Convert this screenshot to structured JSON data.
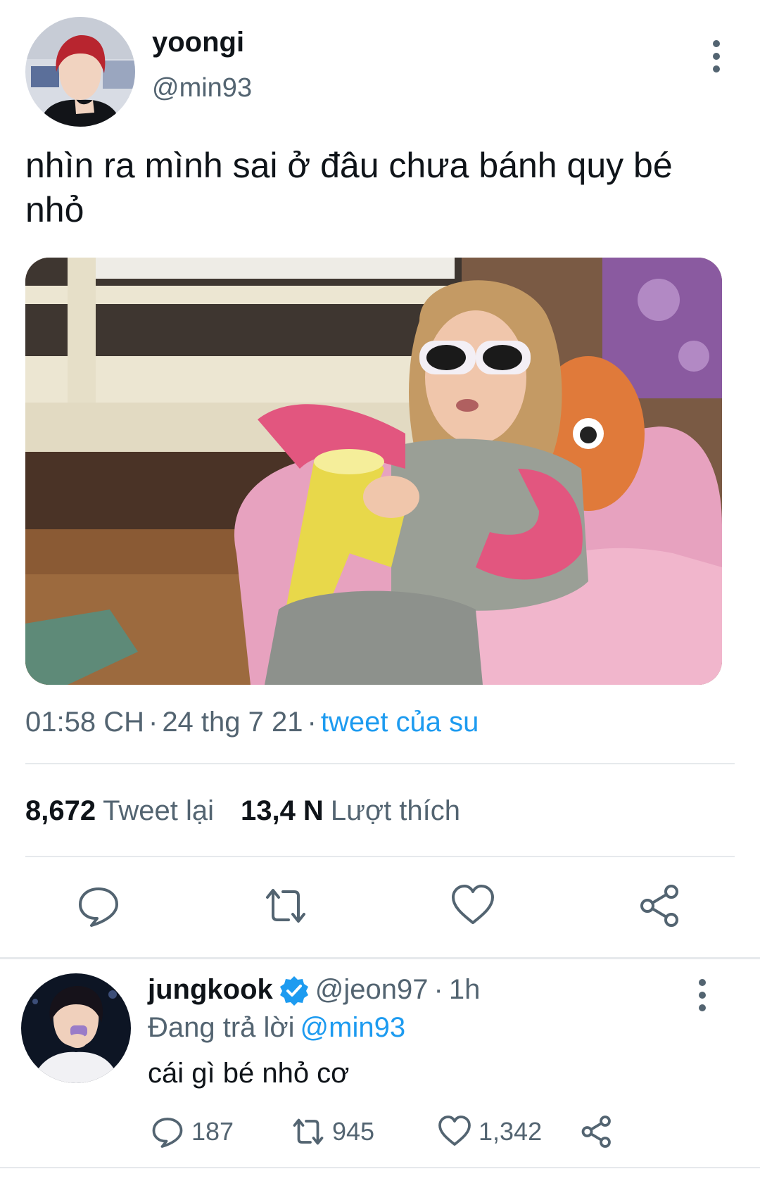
{
  "main_tweet": {
    "display_name": "yoongi",
    "handle": "@min93",
    "text": "nhìn ra mình sai ở đâu chưa bánh quy bé nhỏ",
    "time": "01:58 CH",
    "date": "24 thg 7 21",
    "separator": "·",
    "source": "tweet của su",
    "retweet_count": "8,672",
    "retweet_label": "Tweet lại",
    "like_count": "13,4 N",
    "like_label": "Lượt thích",
    "icons": [
      "more-vertical-icon",
      "reply-icon",
      "retweet-icon",
      "like-icon",
      "share-icon"
    ]
  },
  "reply_tweet": {
    "display_name": "jungkook",
    "handle": "@jeon97",
    "separator": "·",
    "time": "1h",
    "replying_label": "Đang trả lời",
    "replying_to": "@min93",
    "text": "cái gì bé nhỏ cơ",
    "reply_count": "187",
    "retweet_count": "945",
    "like_count": "1,342",
    "icons": [
      "verified-badge-icon",
      "more-vertical-icon",
      "reply-icon",
      "retweet-icon",
      "like-icon",
      "share-icon"
    ]
  },
  "colors": {
    "text_primary": "#0f1419",
    "text_secondary": "#536471",
    "link": "#1d9bf0",
    "divider": "#e6e9ec"
  }
}
